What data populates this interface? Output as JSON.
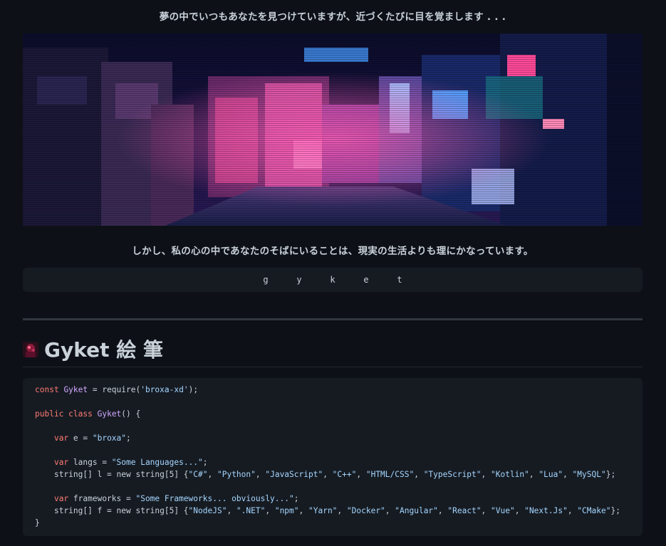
{
  "quotes": {
    "top": "夢の中でいつもあなたを見つけていますが、近づくたびに目を覚まします . . .",
    "middle": "しかし、私の心の中であなたのそばにいることは、現実の生活よりも理にかなっています。"
  },
  "banner": {
    "icon": "neon-alley-image"
  },
  "name_letters": [
    "g",
    "y",
    "k",
    "e",
    "t"
  ],
  "heading": {
    "icon": "anime-avatar-icon",
    "title": "Gyket 絵 筆"
  },
  "code": {
    "line1": {
      "kw": "const",
      "name": "Gyket",
      "op": " = require(",
      "str": "'broxa-xd'",
      "end": ");"
    },
    "line2": {
      "kw1": "public",
      "kw2": "class",
      "name": "Gyket",
      "end": "() {"
    },
    "line3": {
      "kw": "var",
      "rest": " e = ",
      "str": "\"broxa\"",
      "end": ";"
    },
    "line4": {
      "kw": "var",
      "rest": " langs = ",
      "str": "\"Some Languages...\"",
      "end": ";"
    },
    "line5": {
      "prefix": "string[] l = new string[5] {",
      "items": [
        "\"C#\"",
        "\"Python\"",
        "\"JavaScript\"",
        "\"C++\"",
        "\"HTML/CSS\"",
        "\"TypeScript\"",
        "\"Kotlin\"",
        "\"Lua\"",
        "\"MySQL\""
      ],
      "end": "};"
    },
    "line6": {
      "kw": "var",
      "rest": " frameworks = ",
      "str": "\"Some Frameworks... obviously...\"",
      "end": ";"
    },
    "line7": {
      "prefix": "string[] f = new string[5] {",
      "items": [
        "\"NodeJS\"",
        "\".NET\"",
        "\"npm\"",
        "\"Yarn\"",
        "\"Docker\"",
        "\"Angular\"",
        "\"React\"",
        "\"Vue\"",
        "\"Next.Js\"",
        "\"CMake\""
      ],
      "end": "};"
    },
    "line8": "}"
  }
}
